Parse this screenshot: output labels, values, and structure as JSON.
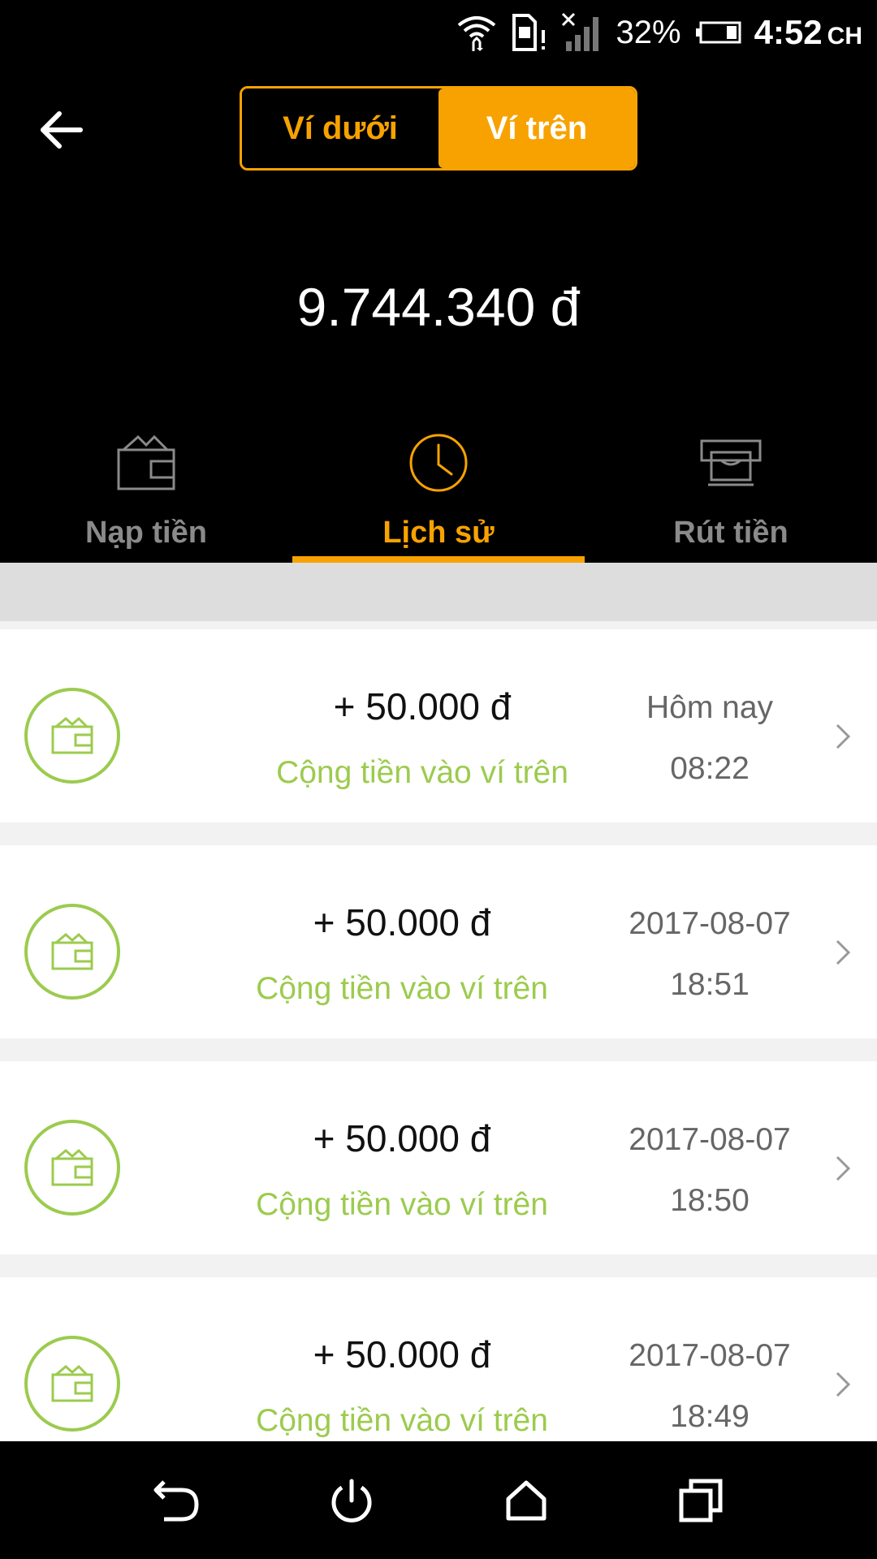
{
  "status_bar": {
    "battery_percent": "32%",
    "time": "4:52",
    "ampm": "CH"
  },
  "header": {
    "segments": [
      {
        "label": "Ví dưới",
        "active": false
      },
      {
        "label": "Ví trên",
        "active": true
      }
    ]
  },
  "balance": "9.744.340 đ",
  "tabs": [
    {
      "label": "Nạp tiền",
      "icon": "wallet-icon",
      "active": false
    },
    {
      "label": "Lịch sử",
      "icon": "clock-icon",
      "active": true
    },
    {
      "label": "Rút tiền",
      "icon": "atm-icon",
      "active": false
    }
  ],
  "transactions": [
    {
      "amount": "+ 50.000 đ",
      "description": "Cộng tiền vào ví trên",
      "date": "Hôm nay",
      "time": "08:22"
    },
    {
      "amount": "+ 50.000 đ",
      "description": "Cộng tiền vào ví trên",
      "date": "2017-08-07",
      "time": "18:51"
    },
    {
      "amount": "+ 50.000 đ",
      "description": "Cộng tiền vào ví trên",
      "date": "2017-08-07",
      "time": "18:50"
    },
    {
      "amount": "+ 50.000 đ",
      "description": "Cộng tiền vào ví trên",
      "date": "2017-08-07",
      "time": "18:49"
    }
  ],
  "colors": {
    "accent": "#f7a200",
    "green": "#9ccb4e",
    "inactive_tab": "#8a8a8a"
  }
}
